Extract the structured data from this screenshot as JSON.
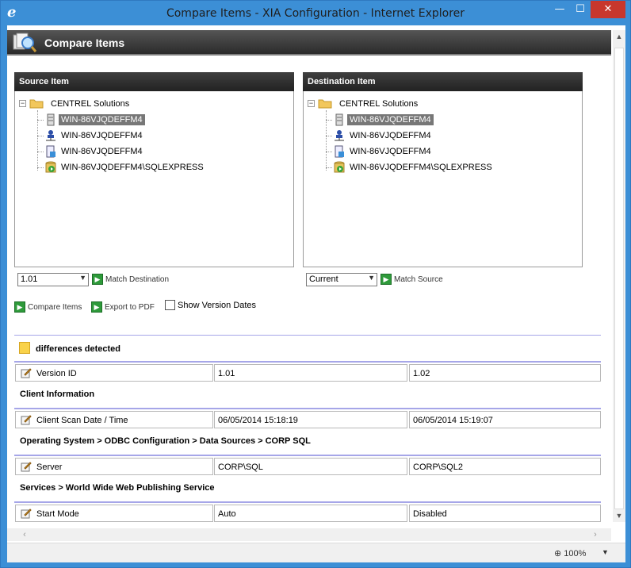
{
  "window": {
    "title": "Compare Items - XIA Configuration - Internet Explorer",
    "minimize": "—",
    "maximize": "☐",
    "close": "✕"
  },
  "header": {
    "title": "Compare Items"
  },
  "source": {
    "title": "Source Item",
    "root": "CENTREL Solutions",
    "items": [
      "WIN-86VJQDEFFM4",
      "WIN-86VJQDEFFM4",
      "WIN-86VJQDEFFM4",
      "WIN-86VJQDEFFM4\\SQLEXPRESS"
    ],
    "version": "1.01",
    "match_label": "Match Destination"
  },
  "destination": {
    "title": "Destination Item",
    "root": "CENTREL Solutions",
    "items": [
      "WIN-86VJQDEFFM4",
      "WIN-86VJQDEFFM4",
      "WIN-86VJQDEFFM4",
      "WIN-86VJQDEFFM4\\SQLEXPRESS"
    ],
    "version": "Current",
    "match_label": "Match Source"
  },
  "actions": {
    "compare": "Compare Items",
    "export": "Export to PDF",
    "show_dates": "Show Version Dates"
  },
  "diff": {
    "heading": "differences detected",
    "rows": [
      {
        "property": "Version ID",
        "source": "1.01",
        "destination": "1.02"
      }
    ],
    "sections": [
      {
        "title": "Client Information",
        "rows": [
          {
            "property": "Client Scan Date / Time",
            "source": "06/05/2014 15:18:19",
            "destination": "06/05/2014 15:19:07"
          }
        ]
      },
      {
        "title": "Operating System > ODBC Configuration > Data Sources > CORP SQL",
        "rows": [
          {
            "property": "Server",
            "source": "CORP\\SQL",
            "destination": "CORP\\SQL2"
          }
        ]
      },
      {
        "title": "Services > World Wide Web Publishing Service",
        "rows": [
          {
            "property": "Start Mode",
            "source": "Auto",
            "destination": "Disabled"
          }
        ]
      }
    ]
  },
  "status": {
    "zoom": "100%"
  },
  "colors": {
    "title_bar": "#3c8fd6",
    "close_button": "#c8372d",
    "accent_line": "#a6a6e8",
    "go_button": "#2e9a3a"
  }
}
